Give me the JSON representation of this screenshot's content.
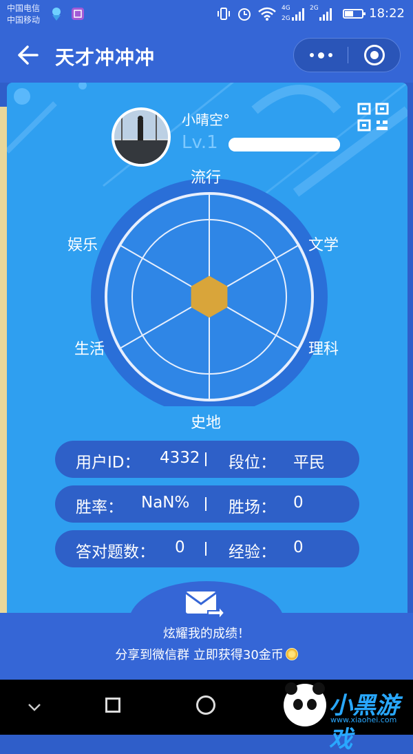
{
  "status_bar": {
    "carrier1": "中国电信",
    "carrier2": "中国移动",
    "network1": "4G",
    "network2": "2G",
    "time": "18:22",
    "battery_fraction": 0.5,
    "icons": [
      "vibrate-icon",
      "alarm-icon",
      "wifi-icon",
      "signal-icon",
      "battery-icon"
    ]
  },
  "navbar": {
    "title": "天才冲冲冲",
    "back_icon": "back-arrow-icon",
    "more_icon": "more-dots-icon",
    "close_icon": "close-circle-icon"
  },
  "profile": {
    "username": "小晴空°",
    "level": "Lv.1",
    "qr_icon": "qr-code-icon"
  },
  "radar": {
    "labels": [
      "流行",
      "文学",
      "理科",
      "史地",
      "生活",
      "娱乐"
    ],
    "values": [
      0.14,
      0.14,
      0.14,
      0.14,
      0.14,
      0.14
    ],
    "accent": "#d9a53a"
  },
  "stats": {
    "user_id_label": "用户ID：",
    "user_id": "4332",
    "rank_label": "段位：",
    "rank": "平民",
    "win_rate_label": "胜率：",
    "win_rate": "NaN%",
    "wins_label": "胜场：",
    "wins": "0",
    "correct_label": "答对题数：",
    "correct": "0",
    "exp_label": "经验：",
    "exp": "0"
  },
  "share": {
    "title": "炫耀我的成绩！",
    "subtitle": "分享到微信群 立即获得30金币",
    "icon": "mail-share-icon",
    "coin_icon": "coin-icon"
  },
  "android_nav": {
    "icons": [
      "nav-back-icon",
      "nav-home-icon",
      "nav-recent-icon"
    ]
  },
  "watermark": {
    "text": "小黑游戏",
    "url": "www.xiaohei.com"
  },
  "colors": {
    "header": "#3566d6",
    "card": "#2f9ff0",
    "pill": "#2e60c8"
  }
}
